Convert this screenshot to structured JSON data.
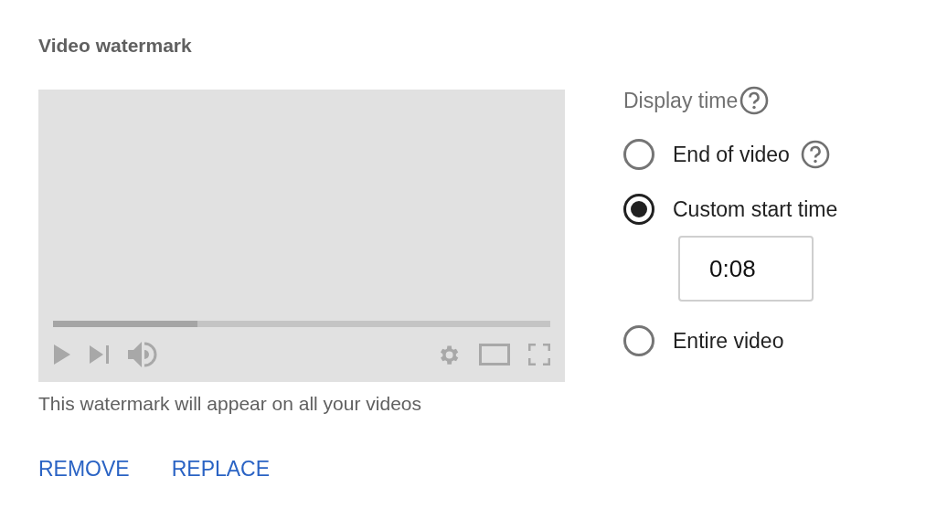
{
  "title": "Video watermark",
  "player": {
    "progress": {
      "level": 0.29
    }
  },
  "caption": "This watermark will appear on all your videos",
  "actions": [
    "REMOVE",
    "REPLACE"
  ],
  "display_time": {
    "label": "Display time",
    "help": true,
    "options": [
      {
        "label": "End of video",
        "selected": false,
        "help": true
      },
      {
        "label": "Custom start time",
        "selected": true,
        "help": false,
        "field": {
          "value": "0:08"
        }
      },
      {
        "label": "Entire video",
        "selected": false,
        "help": false
      }
    ]
  }
}
